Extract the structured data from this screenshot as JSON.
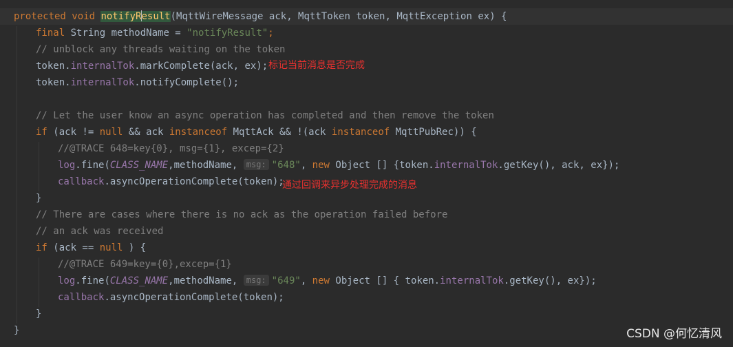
{
  "code": {
    "l1": {
      "k1": "protected",
      "k2": "void",
      "name_a": "notifyR",
      "name_b": "esult",
      "params": "(MqttWireMessage ack, MqttToken token, MqttException ex) {"
    },
    "l2": {
      "k1": "final",
      "rest": " String methodName = ",
      "str": "\"notifyResult\"",
      "end": ";"
    },
    "l3": {
      "cm": "// unblock any threads waiting on the token"
    },
    "l4": {
      "a": "token.",
      "f": "internalTok",
      "b": ".markComplete(ack, ex);"
    },
    "l5": {
      "a": "token.",
      "f": "internalTok",
      "b": ".notifyComplete();"
    },
    "l7": {
      "cm": "// Let the user know an async operation has completed and then remove the token"
    },
    "l8": {
      "k1": "if",
      "a": " (ack != ",
      "k2": "null",
      "b": " && ack ",
      "k3": "instanceof",
      "c": " MqttAck && !(ack ",
      "k4": "instanceof",
      "d": " MqttPubRec)) {"
    },
    "l9": {
      "cm": "//@TRACE 648=key{0}, msg={1}, excep={2}"
    },
    "l10": {
      "f1": "log",
      "a": ".fine(",
      "c1": "CLASS_NAME",
      "b": ",methodName, ",
      "hint": "msg:",
      "str": "\"648\"",
      "c": ", ",
      "k1": "new",
      "d": " Object [] {token.",
      "f2": "internalTok",
      "e": ".getKey(), ack, ex});"
    },
    "l11": {
      "f1": "callback",
      "a": ".asyncOperationComplete(token);"
    },
    "l12": {
      "a": "}"
    },
    "l13": {
      "cm": "// There are cases where there is no ack as the operation failed before"
    },
    "l14": {
      "cm": "// an ack was received"
    },
    "l15": {
      "k1": "if",
      "a": " (ack == ",
      "k2": "null",
      "b": " ) {"
    },
    "l16": {
      "cm": "//@TRACE 649=key={0},excep={1}"
    },
    "l17": {
      "f1": "log",
      "a": ".fine(",
      "c1": "CLASS_NAME",
      "b": ",methodName, ",
      "hint": "msg:",
      "str": "\"649\"",
      "c": ", ",
      "k1": "new",
      "d": " Object [] { token.",
      "f2": "internalTok",
      "e": ".getKey(), ex});"
    },
    "l18": {
      "f1": "callback",
      "a": ".asyncOperationComplete(token);"
    },
    "l19": {
      "a": "}"
    },
    "l20": {
      "a": "}"
    }
  },
  "annotations": {
    "mark_complete": "标记当前消息是否完成",
    "async_complete": "通过回调来异步处理完成的消息"
  },
  "watermark": "CSDN @何忆清风",
  "colors": {
    "background": "#2b2b2b",
    "keyword": "#cc7832",
    "string": "#6a8759",
    "comment": "#808080",
    "field": "#9876aa",
    "method_declaration": "#ffc66d",
    "annotation_text": "#e8312f"
  }
}
